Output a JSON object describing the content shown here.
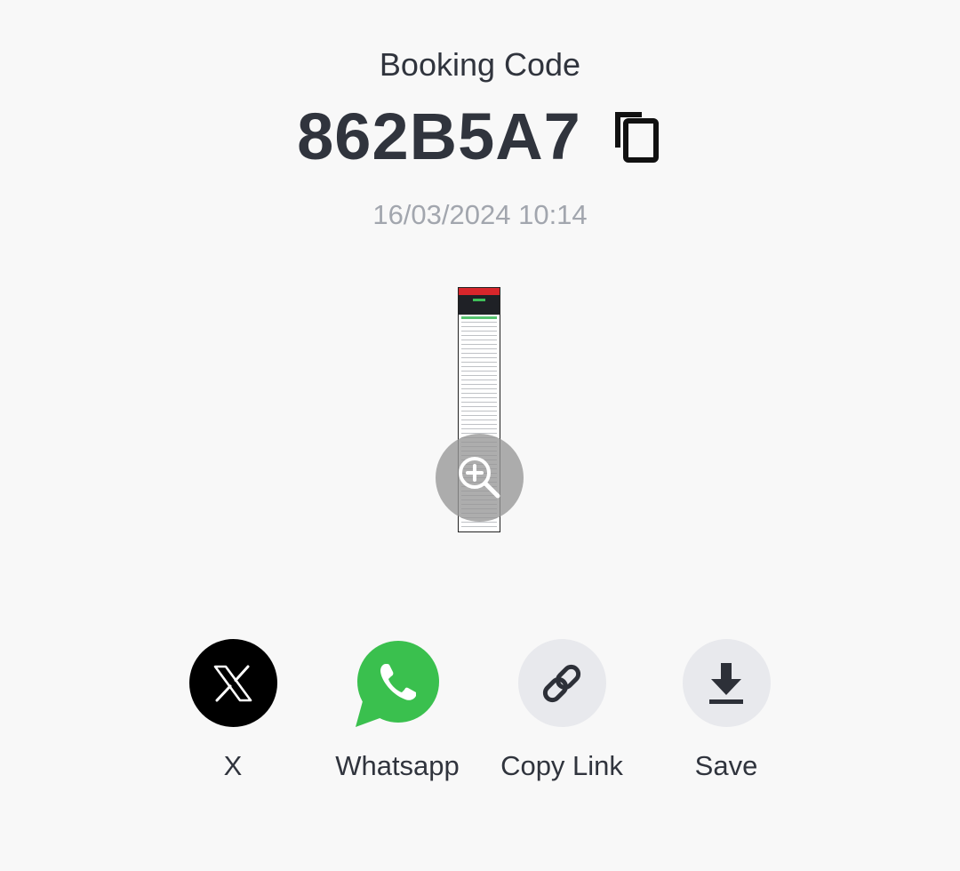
{
  "booking": {
    "title": "Booking Code",
    "code": "862B5A7",
    "timestamp": "16/03/2024 10:14"
  },
  "icons": {
    "copy": "copy-icon",
    "zoom": "zoom-in-icon",
    "x": "x-logo-icon",
    "whatsapp": "whatsapp-icon",
    "link": "link-icon",
    "download": "download-icon"
  },
  "share": {
    "x_label": "X",
    "whatsapp_label": "Whatsapp",
    "copy_link_label": "Copy Link",
    "save_label": "Save"
  },
  "colors": {
    "text_primary": "#30343d",
    "text_secondary": "#a2a6ae",
    "whatsapp_green": "#3ac04e",
    "x_black": "#000000",
    "neutral_circle": "#e8e9ed",
    "background": "#f8f8f8"
  }
}
